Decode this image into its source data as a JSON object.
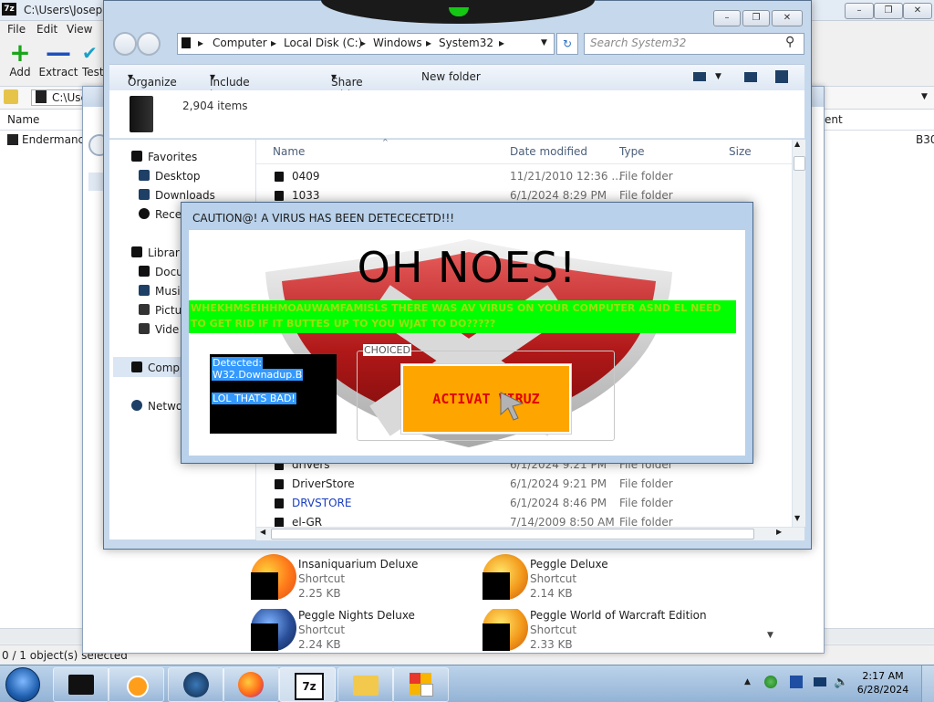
{
  "zip": {
    "title": "C:\\Users\\Joseph",
    "menu": [
      "File",
      "Edit",
      "View"
    ],
    "toolbar": [
      {
        "icon": "add-plus-icon",
        "label": "Add",
        "color": "#19a519"
      },
      {
        "icon": "extract-minus-icon",
        "label": "Extract",
        "color": "#1d4fbf"
      },
      {
        "icon": "test-check-icon",
        "label": "Test",
        "color": "#1aa0c8"
      }
    ],
    "address": "C:\\Users\\Jo",
    "columns": {
      "name": "Name",
      "right": "ent"
    },
    "row": {
      "name": "Endermanch",
      "right": "B30"
    },
    "status": "0 / 1 object(s) selected"
  },
  "explorer": {
    "breadcrumb": [
      "Computer",
      "Local Disk (C:)",
      "Windows",
      "System32"
    ],
    "search_placeholder": "Search System32",
    "commands": [
      "Organize",
      "Include in library",
      "Share with",
      "New folder"
    ],
    "item_count": "2,904 items",
    "nav": {
      "favorites_header": "Favorites",
      "favorites": [
        "Desktop",
        "Downloads",
        "Rece"
      ],
      "libraries_header": "Librari",
      "libraries": [
        "Docu",
        "Musi",
        "Pictu",
        "Vide"
      ],
      "computer": "Compu",
      "network": "Netwo"
    },
    "columns": {
      "name": "Name",
      "date": "Date modified",
      "type": "Type",
      "size": "Size"
    },
    "rows_top": [
      {
        "name": "0409",
        "date": "11/21/2010 12:36 ...",
        "type": "File folder"
      },
      {
        "name": "1033",
        "date": "6/1/2024 8:29 PM",
        "type": "File folder"
      }
    ],
    "rows_bottom": [
      {
        "name": "drivers",
        "date": "6/1/2024 9:21 PM",
        "type": "File folder",
        "color": "#1e1e1e"
      },
      {
        "name": "DriverStore",
        "date": "6/1/2024 9:21 PM",
        "type": "File folder",
        "color": "#1e1e1e"
      },
      {
        "name": "DRVSTORE",
        "date": "6/1/2024 8:46 PM",
        "type": "File folder",
        "color": "#1a3fbf"
      },
      {
        "name": "el-GR",
        "date": "7/14/2009 8:50 AM",
        "type": "File folder",
        "color": "#1e1e1e"
      }
    ]
  },
  "shortcuts": [
    {
      "name": "Insaniquarium Deluxe",
      "kind": "Shortcut",
      "size": "2.25 KB"
    },
    {
      "name": "Peggle Deluxe",
      "kind": "Shortcut",
      "size": "2.14 KB"
    },
    {
      "name": "Peggle Nights Deluxe",
      "kind": "Shortcut",
      "size": "2.24 KB"
    },
    {
      "name": "Peggle World of Warcraft Edition",
      "kind": "Shortcut",
      "size": "2.33 KB"
    }
  ],
  "dialog": {
    "title": "CAUTION@! A VIRUS HAS BEEN DETECECETD!!!",
    "headline": "OH NOES!",
    "banner": "WHEKHMSEIHHMOAUWAMFAMISLS THERE WAS AV VIRUS ON YOUR COMPUTER ASND EL NEED TO GET RID IF IT BUTTES UP TO YOU WJAT TO DO?????",
    "detected_lines": [
      "Detected:",
      "W32.Downadup.B",
      "",
      "LOL THATS BAD!"
    ],
    "group_label": "CHOICED",
    "button_label": "ACTIVAT VIRUZ",
    "colors": {
      "banner": "#00ff00",
      "button": "#ffa500",
      "button_text": "#e00000"
    }
  },
  "taskbar": {
    "time": "2:17 AM",
    "date": "6/28/2024",
    "buttons": [
      "start-orb-icon",
      "dark-app-icon",
      "media-player-icon",
      "dark-orb-app-icon",
      "firefox-icon",
      "7zip-icon",
      "folder-explorer-icon",
      "window-app-icon"
    ]
  }
}
